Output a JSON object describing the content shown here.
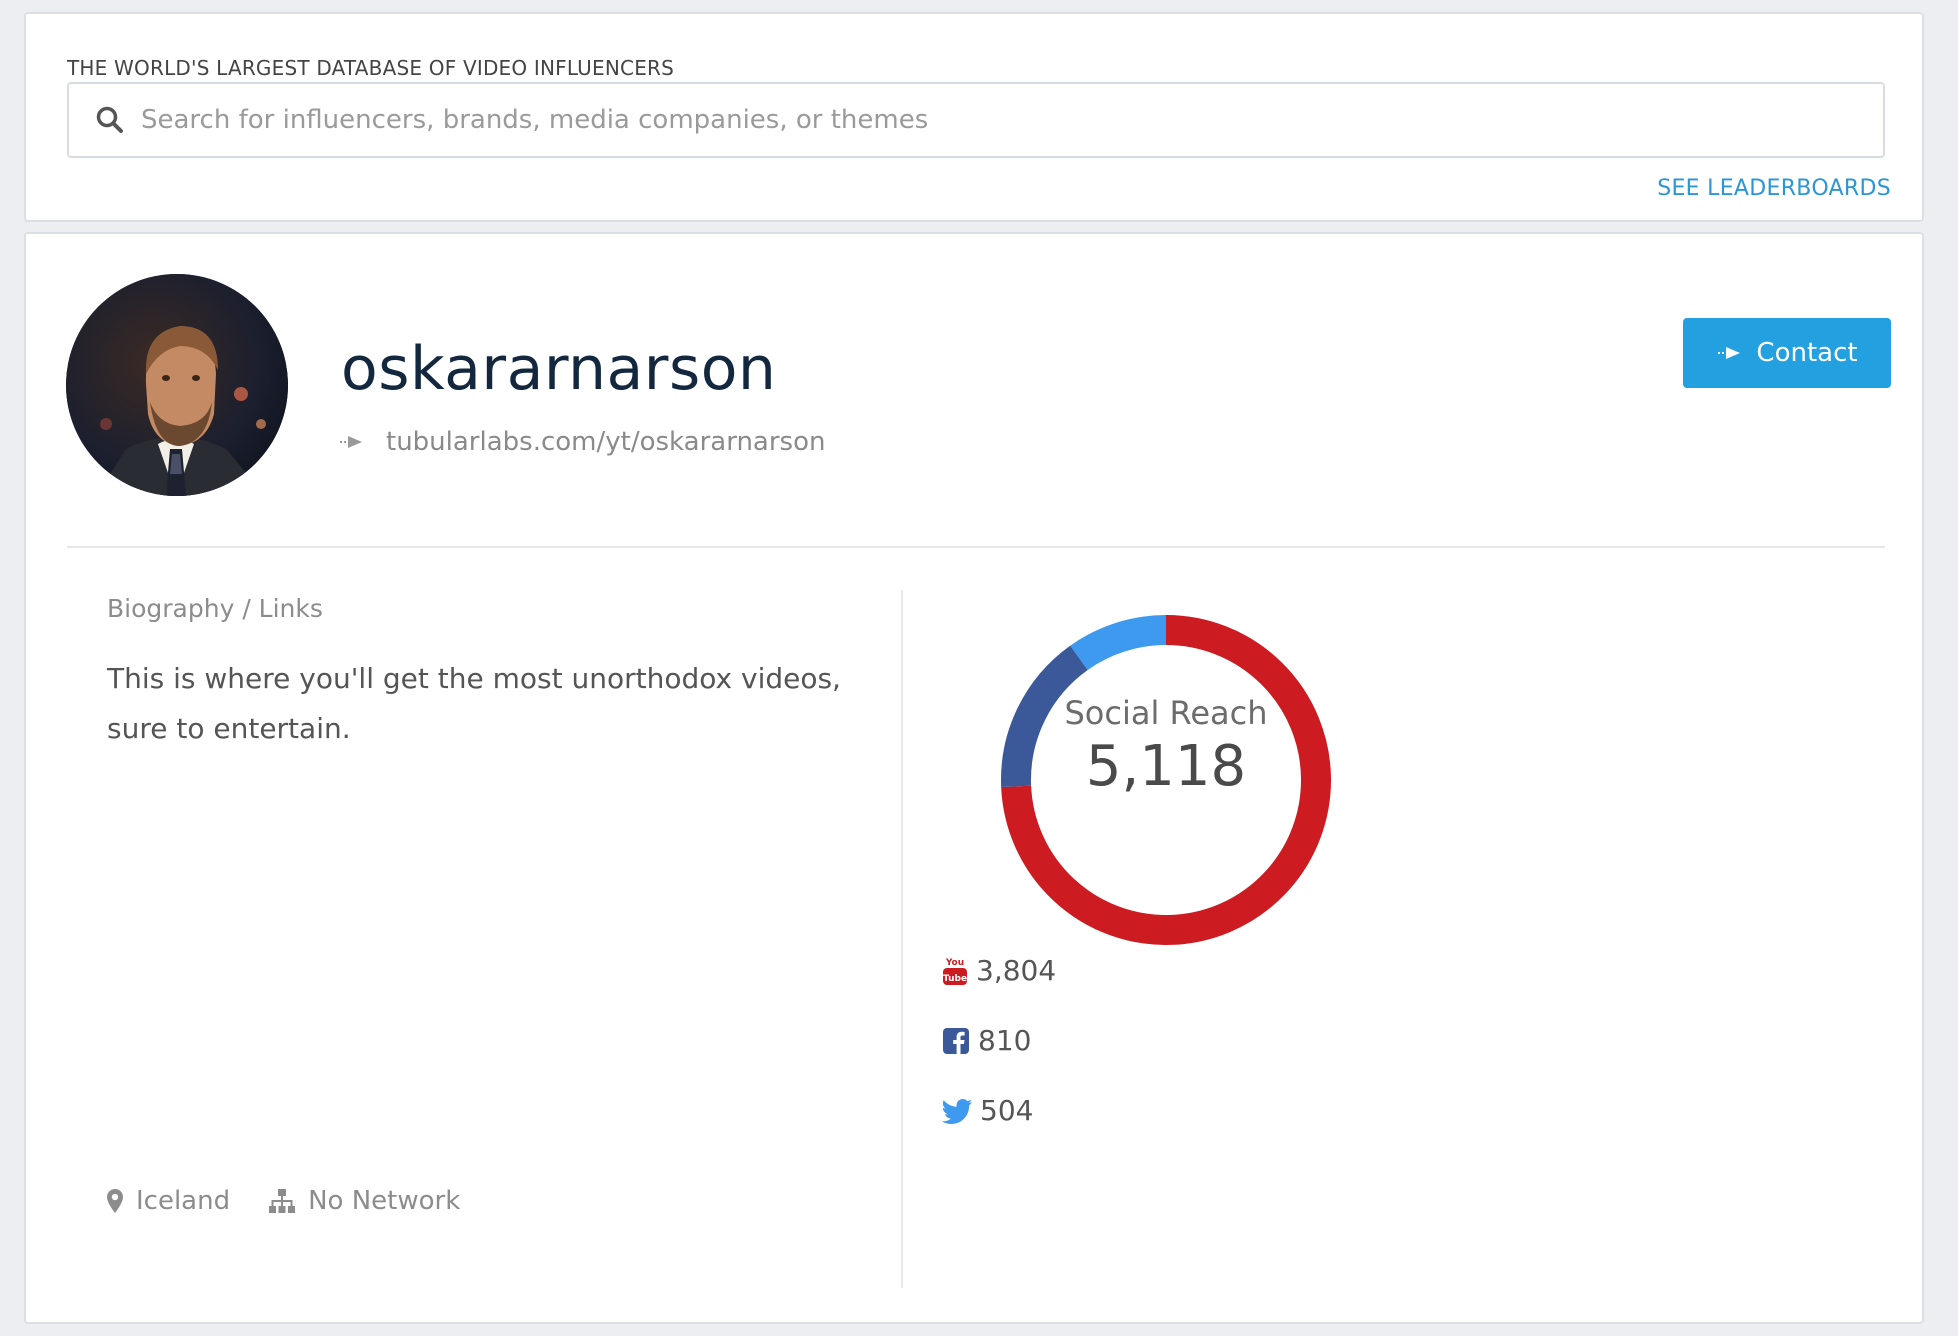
{
  "header": {
    "tagline": "THE WORLD'S LARGEST DATABASE OF VIDEO INFLUENCERS",
    "search_placeholder": "Search for influencers, brands, media companies, or themes",
    "search_icon": "search-icon",
    "leaderboards_link": "SEE LEADERBOARDS"
  },
  "profile": {
    "name": "oskararnarson",
    "url": "tubularlabs.com/yt/oskararnarson",
    "contact_label": "Contact",
    "avatar": "avatar"
  },
  "bio": {
    "heading": "Biography / Links",
    "text": "This is where you'll get the most unorthodox videos, sure to entertain.",
    "location": "Iceland",
    "network": "No Network"
  },
  "reach": {
    "label": "Social Reach",
    "total": "5,118",
    "platforms": [
      {
        "name": "youtube",
        "icon": "youtube-icon",
        "count": "3,804",
        "value": 3804,
        "color": "#cc1c22"
      },
      {
        "name": "facebook",
        "icon": "facebook-icon",
        "count": "810",
        "value": 810,
        "color": "#3b5998"
      },
      {
        "name": "twitter",
        "icon": "twitter-icon",
        "count": "504",
        "value": 504,
        "color": "#3d9aee"
      }
    ]
  },
  "colors": {
    "accent": "#23a0e0",
    "link": "#2a96d8",
    "youtube": "#cc1c22",
    "facebook": "#3b5998",
    "twitter": "#3d9aee"
  }
}
